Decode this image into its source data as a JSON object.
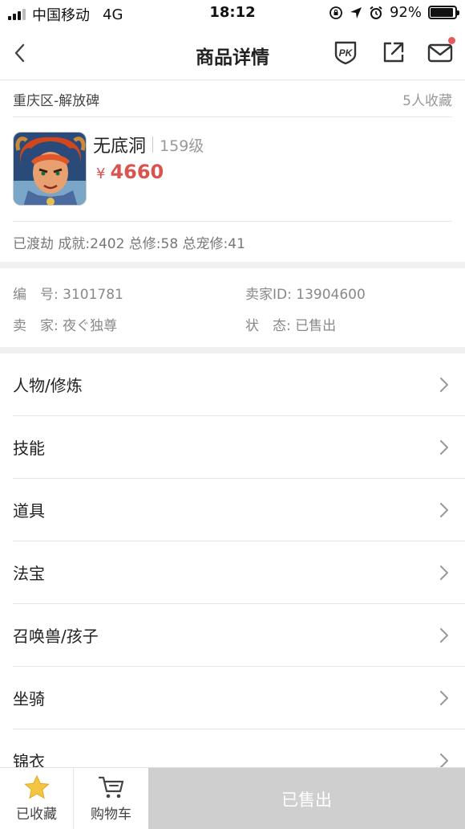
{
  "status_bar": {
    "carrier": "中国移动",
    "network": "4G",
    "time": "18:12",
    "battery": "92%"
  },
  "nav": {
    "title": "商品详情",
    "icons": [
      "back-icon",
      "pk-icon",
      "share-icon",
      "mail-icon"
    ],
    "notification_dot_color": "#e85a5a"
  },
  "location": {
    "text": "重庆区-解放碑",
    "favorites": "5人收藏"
  },
  "product": {
    "name": "无底洞",
    "level": "159级",
    "price_symbol": "¥",
    "price": "4660",
    "price_color": "#d9534f"
  },
  "stats": {
    "text": "已渡劫 成就:2402 总修:58 总宠修:41"
  },
  "info": {
    "id_label": "编　号:",
    "id_value": "3101781",
    "seller_id_label": "卖家ID:",
    "seller_id_value": "13904600",
    "seller_label": "卖　家:",
    "seller_value": "夜ぐ独尊",
    "status_label": "状　态:",
    "status_value": "已售出"
  },
  "sections": [
    {
      "label": "人物/修炼"
    },
    {
      "label": "技能"
    },
    {
      "label": "道具"
    },
    {
      "label": "法宝"
    },
    {
      "label": "召唤兽/孩子"
    },
    {
      "label": "坐骑"
    },
    {
      "label": "锦衣"
    }
  ],
  "bottom_bar": {
    "favorite_label": "已收藏",
    "cart_label": "购物车",
    "action_label": "已售出",
    "star_color": "#f5c542"
  }
}
